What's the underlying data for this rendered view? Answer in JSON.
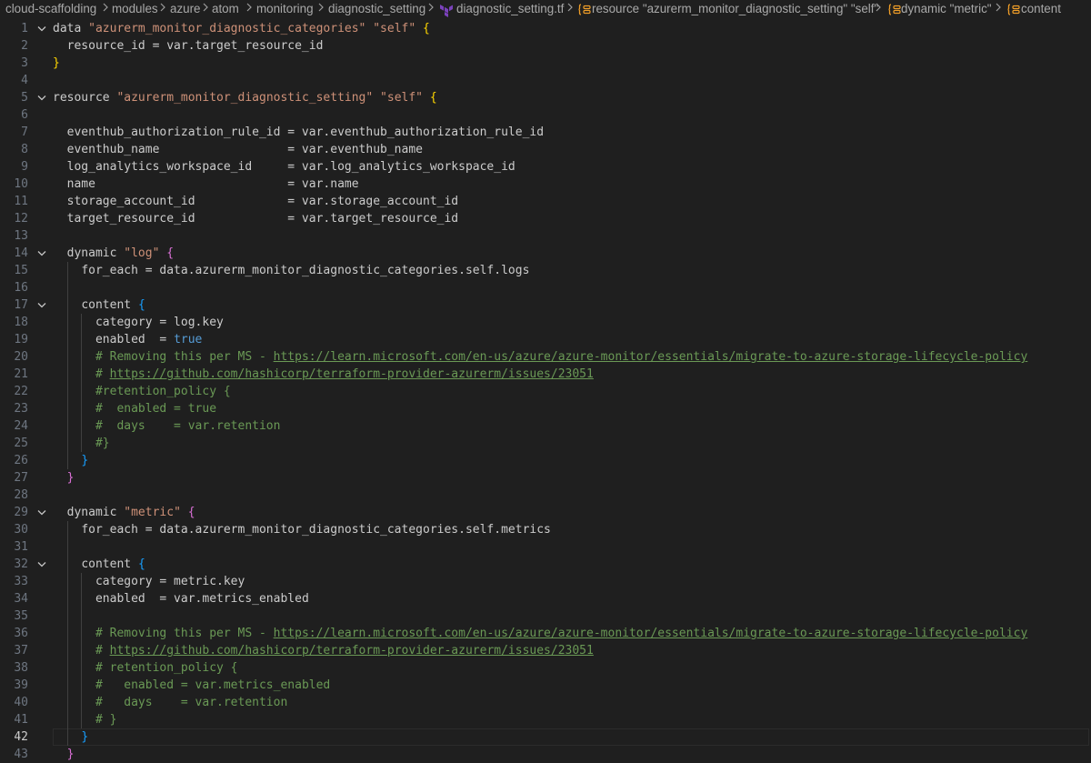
{
  "breadcrumb": {
    "segments": [
      "cloud-scaffolding",
      "modules",
      "azure",
      "atom",
      "monitoring",
      "diagnostic_setting",
      "diagnostic_setting.tf",
      "resource \"azurerm_monitor_diagnostic_setting\" \"self\"",
      "dynamic \"metric\"",
      "content"
    ],
    "separator": ">"
  },
  "editor": {
    "current_line": 42,
    "lines": [
      {
        "n": "1",
        "fold": true,
        "indent": 0,
        "tokens": [
          [
            "t-kw",
            "data "
          ],
          [
            "t-str",
            "\"azurerm_monitor_diagnostic_categories\""
          ],
          [
            "t-kw",
            " "
          ],
          [
            "t-str",
            "\"self\""
          ],
          [
            "t-kw",
            " "
          ],
          [
            "b1",
            "{"
          ]
        ]
      },
      {
        "n": "2",
        "indent": 1,
        "tokens": [
          [
            "t-id",
            "resource_id = var.target_resource_id"
          ]
        ]
      },
      {
        "n": "3",
        "indent": 0,
        "tokens": [
          [
            "b1",
            "}"
          ]
        ]
      },
      {
        "n": "4",
        "indent": 0,
        "tokens": []
      },
      {
        "n": "5",
        "fold": true,
        "indent": 0,
        "tokens": [
          [
            "t-kw",
            "resource "
          ],
          [
            "t-str",
            "\"azurerm_monitor_diagnostic_setting\""
          ],
          [
            "t-kw",
            " "
          ],
          [
            "t-str",
            "\"self\""
          ],
          [
            "t-kw",
            " "
          ],
          [
            "b1",
            "{"
          ]
        ]
      },
      {
        "n": "6",
        "indent": 1,
        "tokens": []
      },
      {
        "n": "7",
        "indent": 1,
        "tokens": [
          [
            "t-id",
            "eventhub_authorization_rule_id = var.eventhub_authorization_rule_id"
          ]
        ]
      },
      {
        "n": "8",
        "indent": 1,
        "tokens": [
          [
            "t-id",
            "eventhub_name                  = var.eventhub_name"
          ]
        ]
      },
      {
        "n": "9",
        "indent": 1,
        "tokens": [
          [
            "t-id",
            "log_analytics_workspace_id     = var.log_analytics_workspace_id"
          ]
        ]
      },
      {
        "n": "10",
        "indent": 1,
        "tokens": [
          [
            "t-id",
            "name                           = var.name"
          ]
        ]
      },
      {
        "n": "11",
        "indent": 1,
        "tokens": [
          [
            "t-id",
            "storage_account_id             = var.storage_account_id"
          ]
        ]
      },
      {
        "n": "12",
        "indent": 1,
        "tokens": [
          [
            "t-id",
            "target_resource_id             = var.target_resource_id"
          ]
        ]
      },
      {
        "n": "13",
        "indent": 1,
        "tokens": []
      },
      {
        "n": "14",
        "fold": true,
        "indent": 1,
        "tokens": [
          [
            "t-kw",
            "dynamic "
          ],
          [
            "t-str",
            "\"log\""
          ],
          [
            "t-kw",
            " "
          ],
          [
            "b2",
            "{"
          ]
        ]
      },
      {
        "n": "15",
        "indent": 2,
        "tokens": [
          [
            "t-id",
            "for_each = data.azurerm_monitor_diagnostic_categories.self.logs"
          ]
        ]
      },
      {
        "n": "16",
        "indent": 2,
        "tokens": []
      },
      {
        "n": "17",
        "fold": true,
        "indent": 2,
        "tokens": [
          [
            "t-kw",
            "content "
          ],
          [
            "b3",
            "{"
          ]
        ]
      },
      {
        "n": "18",
        "indent": 3,
        "tokens": [
          [
            "t-id",
            "category = log.key"
          ]
        ]
      },
      {
        "n": "19",
        "indent": 3,
        "tokens": [
          [
            "t-id",
            "enabled  = "
          ],
          [
            "t-bool",
            "true"
          ]
        ]
      },
      {
        "n": "20",
        "indent": 3,
        "tokens": [
          [
            "t-com",
            "# Removing this per MS - "
          ],
          [
            "t-link",
            "https://learn.microsoft.com/en-us/azure/azure-monitor/essentials/migrate-to-azure-storage-lifecycle-policy"
          ]
        ]
      },
      {
        "n": "21",
        "indent": 3,
        "tokens": [
          [
            "t-com",
            "# "
          ],
          [
            "t-link",
            "https://github.com/hashicorp/terraform-provider-azurerm/issues/23051"
          ]
        ]
      },
      {
        "n": "22",
        "indent": 3,
        "tokens": [
          [
            "t-com",
            "#retention_policy {"
          ]
        ]
      },
      {
        "n": "23",
        "indent": 3,
        "tokens": [
          [
            "t-com",
            "#  enabled = true"
          ]
        ]
      },
      {
        "n": "24",
        "indent": 3,
        "tokens": [
          [
            "t-com",
            "#  days    = var.retention"
          ]
        ]
      },
      {
        "n": "25",
        "indent": 3,
        "tokens": [
          [
            "t-com",
            "#}"
          ]
        ]
      },
      {
        "n": "26",
        "indent": 2,
        "tokens": [
          [
            "b3",
            "}"
          ]
        ]
      },
      {
        "n": "27",
        "indent": 1,
        "tokens": [
          [
            "b2",
            "}"
          ]
        ]
      },
      {
        "n": "28",
        "indent": 1,
        "tokens": []
      },
      {
        "n": "29",
        "fold": true,
        "indent": 1,
        "tokens": [
          [
            "t-kw",
            "dynamic "
          ],
          [
            "t-str",
            "\"metric\""
          ],
          [
            "t-kw",
            " "
          ],
          [
            "b2",
            "{"
          ]
        ]
      },
      {
        "n": "30",
        "indent": 2,
        "tokens": [
          [
            "t-id",
            "for_each = data.azurerm_monitor_diagnostic_categories.self.metrics"
          ]
        ]
      },
      {
        "n": "31",
        "indent": 2,
        "tokens": []
      },
      {
        "n": "32",
        "fold": true,
        "indent": 2,
        "tokens": [
          [
            "t-kw",
            "content "
          ],
          [
            "b3",
            "{"
          ]
        ]
      },
      {
        "n": "33",
        "indent": 3,
        "tokens": [
          [
            "t-id",
            "category = metric.key"
          ]
        ]
      },
      {
        "n": "34",
        "indent": 3,
        "tokens": [
          [
            "t-id",
            "enabled  = var.metrics_enabled"
          ]
        ]
      },
      {
        "n": "35",
        "indent": 3,
        "tokens": []
      },
      {
        "n": "36",
        "indent": 3,
        "tokens": [
          [
            "t-com",
            "# Removing this per MS - "
          ],
          [
            "t-link",
            "https://learn.microsoft.com/en-us/azure/azure-monitor/essentials/migrate-to-azure-storage-lifecycle-policy"
          ]
        ]
      },
      {
        "n": "37",
        "indent": 3,
        "tokens": [
          [
            "t-com",
            "# "
          ],
          [
            "t-link",
            "https://github.com/hashicorp/terraform-provider-azurerm/issues/23051"
          ]
        ]
      },
      {
        "n": "38",
        "indent": 3,
        "tokens": [
          [
            "t-com",
            "# retention_policy {"
          ]
        ]
      },
      {
        "n": "39",
        "indent": 3,
        "tokens": [
          [
            "t-com",
            "#   enabled = var.metrics_enabled"
          ]
        ]
      },
      {
        "n": "40",
        "indent": 3,
        "tokens": [
          [
            "t-com",
            "#   days    = var.retention"
          ]
        ]
      },
      {
        "n": "41",
        "indent": 3,
        "tokens": [
          [
            "t-com",
            "# }"
          ]
        ]
      },
      {
        "n": "42",
        "indent": 2,
        "tokens": [
          [
            "b3",
            "}"
          ]
        ]
      },
      {
        "n": "43",
        "indent": 1,
        "tokens": [
          [
            "b2",
            "}"
          ]
        ]
      }
    ]
  },
  "colors": {
    "background": "#1f1f1f",
    "string": "#ce9178",
    "comment": "#6a9955",
    "boolean": "#569cd6",
    "bracket_level1": "#ffd700",
    "bracket_level2": "#da70d6",
    "bracket_level3": "#179fff",
    "terraform_icon": "#7b42bc",
    "symbol_icon": "#ee9d28"
  }
}
